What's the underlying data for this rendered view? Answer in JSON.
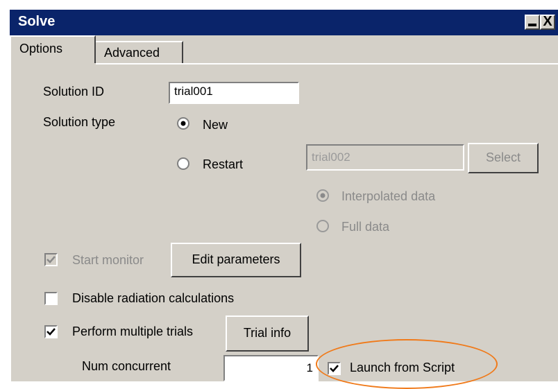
{
  "window": {
    "title": "Solve",
    "minimize_icon": "minimize-icon",
    "close_icon": "close-icon",
    "close_glyph": "X"
  },
  "tabs": [
    {
      "label": "Options",
      "active": true
    },
    {
      "label": "Advanced",
      "active": false
    }
  ],
  "solution_id": {
    "label": "Solution ID",
    "value": "trial001"
  },
  "solution_type": {
    "label": "Solution type",
    "options": [
      {
        "label": "New",
        "selected": true
      },
      {
        "label": "Restart",
        "selected": false
      }
    ]
  },
  "restart": {
    "value": "trial002",
    "select_label": "Select",
    "data_options": [
      {
        "label": "Interpolated data",
        "selected": true,
        "enabled": false
      },
      {
        "label": "Full data",
        "selected": false,
        "enabled": false
      }
    ]
  },
  "monitor": {
    "label": "Start monitor",
    "checked": true,
    "enabled": false,
    "edit_label": "Edit parameters"
  },
  "disable_radiation": {
    "label": "Disable radiation calculations",
    "checked": false
  },
  "multiple_trials": {
    "label": "Perform multiple trials",
    "checked": true,
    "trial_info_label": "Trial info"
  },
  "num_concurrent": {
    "label": "Num concurrent",
    "value": "1"
  },
  "launch_from_script": {
    "label": "Launch from Script",
    "checked": true
  },
  "colors": {
    "titlebar": "#0a246a",
    "face": "#d4d0c8",
    "highlight_ellipse": "#f07a1a"
  }
}
